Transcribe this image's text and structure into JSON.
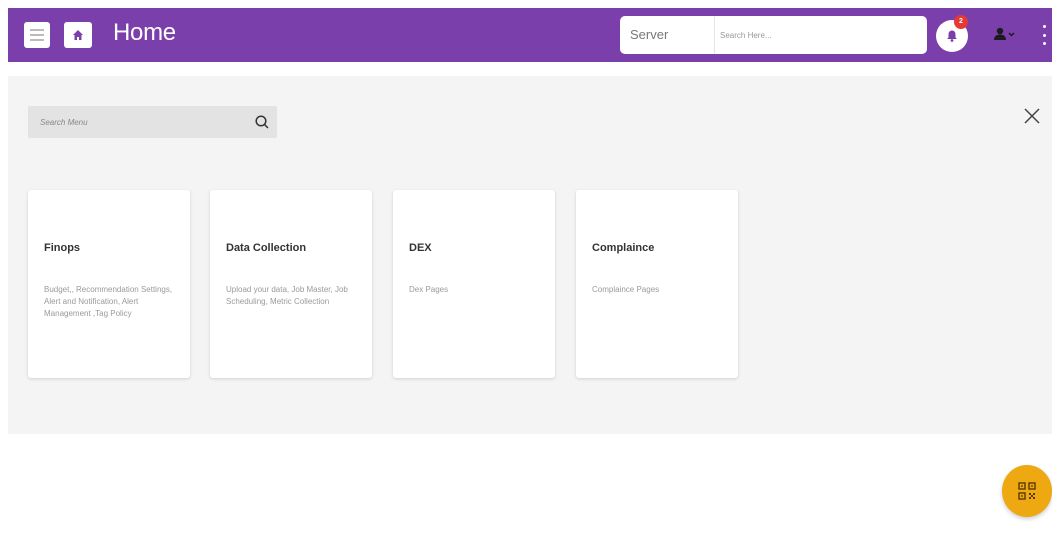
{
  "header": {
    "title": "Home",
    "menu_icon": "hamburger-icon",
    "home_icon": "home-icon",
    "server_label": "Server",
    "search_placeholder": "Search Here...",
    "notification_count": "2",
    "notification_icon": "bell-icon",
    "user_icon": "user-dropdown-icon",
    "more_icon": "kebab-icon",
    "colors": {
      "bar": "#7b3fab",
      "badge": "#e53935"
    }
  },
  "menu": {
    "search_placeholder": "Search Menu",
    "search_icon": "search-icon",
    "close_icon": "close-icon",
    "cards": [
      {
        "title": "Finops",
        "description": "Budget,, Recommendation Settings, Alert and Notification, Alert Management ,Tag Policy"
      },
      {
        "title": "Data Collection",
        "description": "Upload your data, Job Master, Job Scheduling, Metric Collection"
      },
      {
        "title": "DEX",
        "description": "Dex Pages"
      },
      {
        "title": "Complaince",
        "description": "Complaince Pages"
      }
    ]
  },
  "fab": {
    "icon": "qr-code-icon",
    "color": "#eda812"
  }
}
